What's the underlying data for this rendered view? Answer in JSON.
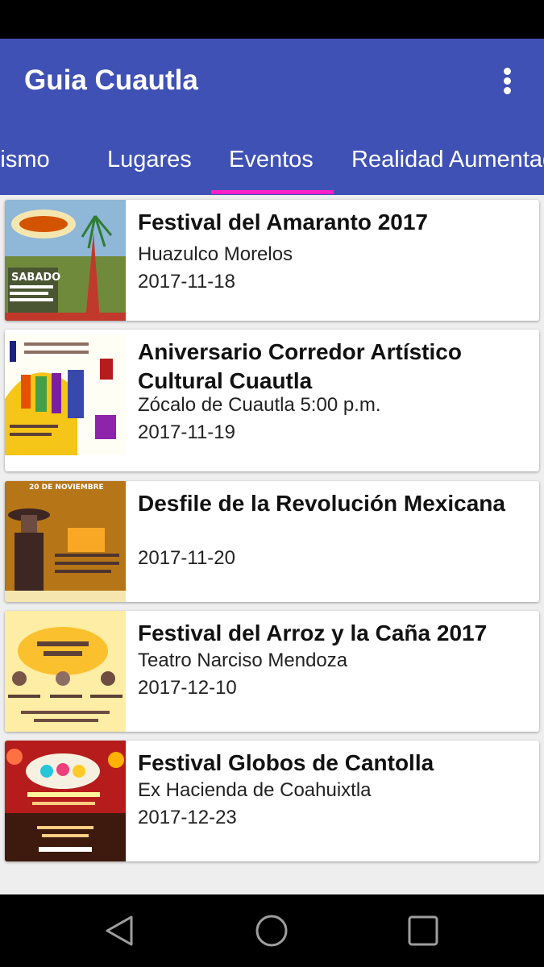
{
  "app": {
    "title": "Guia Cuautla"
  },
  "tabs": [
    {
      "label": "Turismo"
    },
    {
      "label": "Lugares"
    },
    {
      "label": "Eventos"
    },
    {
      "label": "Realidad Aumentada"
    }
  ],
  "selected_tab": "Eventos",
  "events": [
    {
      "title": "Festival del Amaranto 2017",
      "place": "Huazulco Morelos",
      "date": "2017-11-18"
    },
    {
      "title": "Aniversario Corredor Artístico Cultural Cuautla",
      "place": "Zócalo de Cuautla 5:00 p.m.",
      "date": "2017-11-19"
    },
    {
      "title": "Desfile de la Revolución Mexicana",
      "place": "",
      "date": "2017-11-20"
    },
    {
      "title": "Festival del Arroz y la Caña 2017",
      "place": "Teatro Narciso Mendoza",
      "date": "2017-12-10"
    },
    {
      "title": "Festival Globos de Cantolla",
      "place": "Ex Hacienda de Coahuixtla",
      "date": "2017-12-23"
    }
  ],
  "posters": {
    "amaranto": "SABADO",
    "revolucion": "20 DE NOVIEMBRE"
  },
  "colors": {
    "primary": "#3f51b5",
    "accent": "#ff1fc8"
  },
  "icons": {
    "overflow": "more-vert-icon",
    "nav_back": "back-triangle-icon",
    "nav_home": "home-circle-icon",
    "nav_recents": "recents-square-icon"
  }
}
